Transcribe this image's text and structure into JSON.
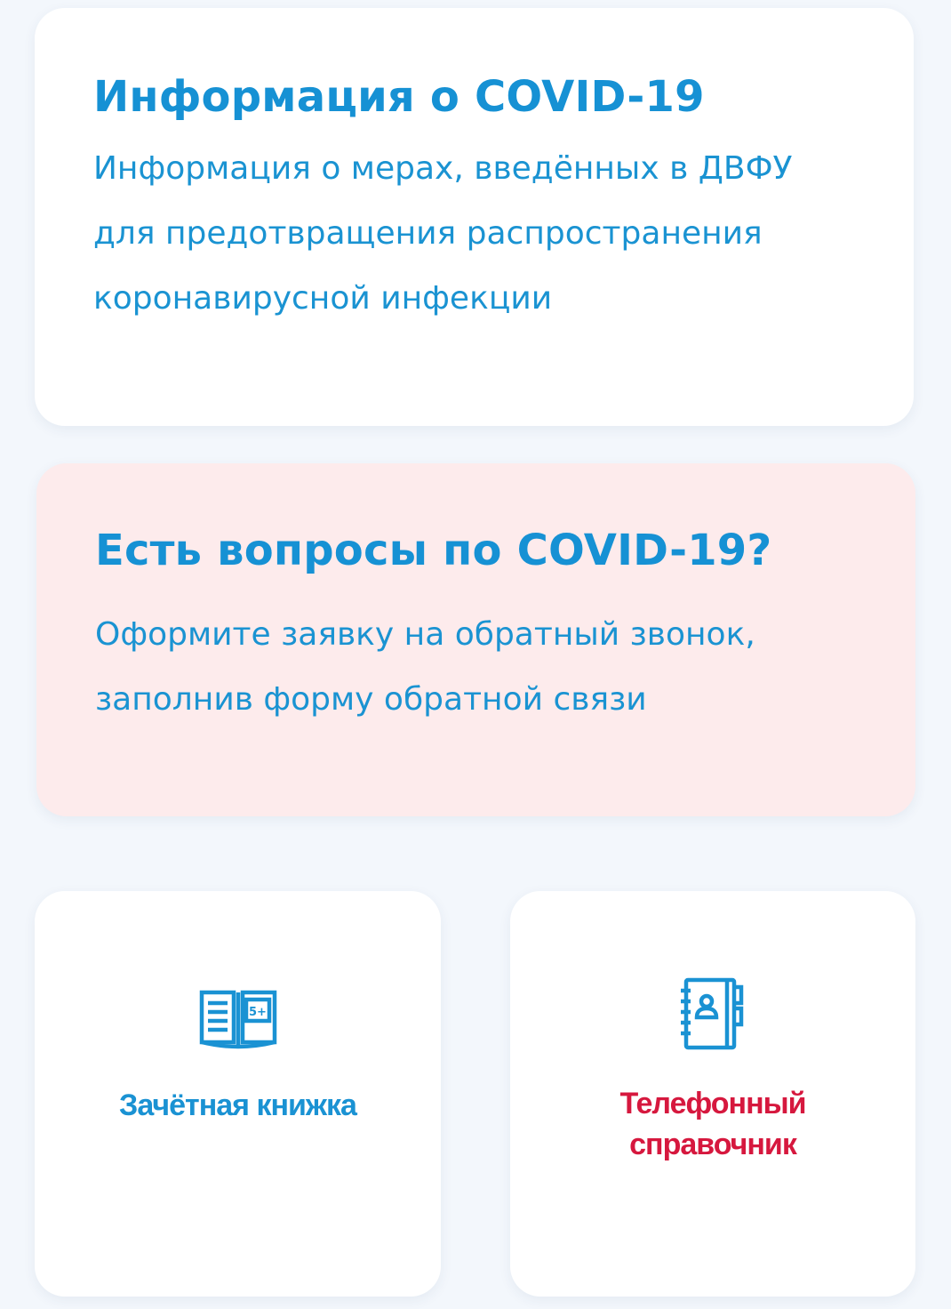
{
  "info_card": {
    "title": "Информация о COVID-19",
    "text_lines": [
      "Информация о мерах, введённых в ДВФУ",
      "для предотвращения распространения",
      "коронавирусной инфекции"
    ]
  },
  "questions_card": {
    "title": "Есть вопросы по COVID-19?",
    "text_lines": [
      "Оформите заявку на обратный звонок,",
      "заполнив форму обратной связи"
    ],
    "background_color": "#fdebec"
  },
  "tiles": [
    {
      "icon": "open-book-icon",
      "icon_badge": "5+",
      "label_lines": [
        "Зачётная книжка"
      ],
      "color": "#1a92d3"
    },
    {
      "icon": "phone-book-icon",
      "label_lines": [
        "Телефонный",
        "справочник"
      ],
      "color": "#d6183e"
    }
  ],
  "colors": {
    "accent_blue": "#1691d4",
    "accent_red": "#d6183e",
    "page_background": "#f3f7fc"
  }
}
